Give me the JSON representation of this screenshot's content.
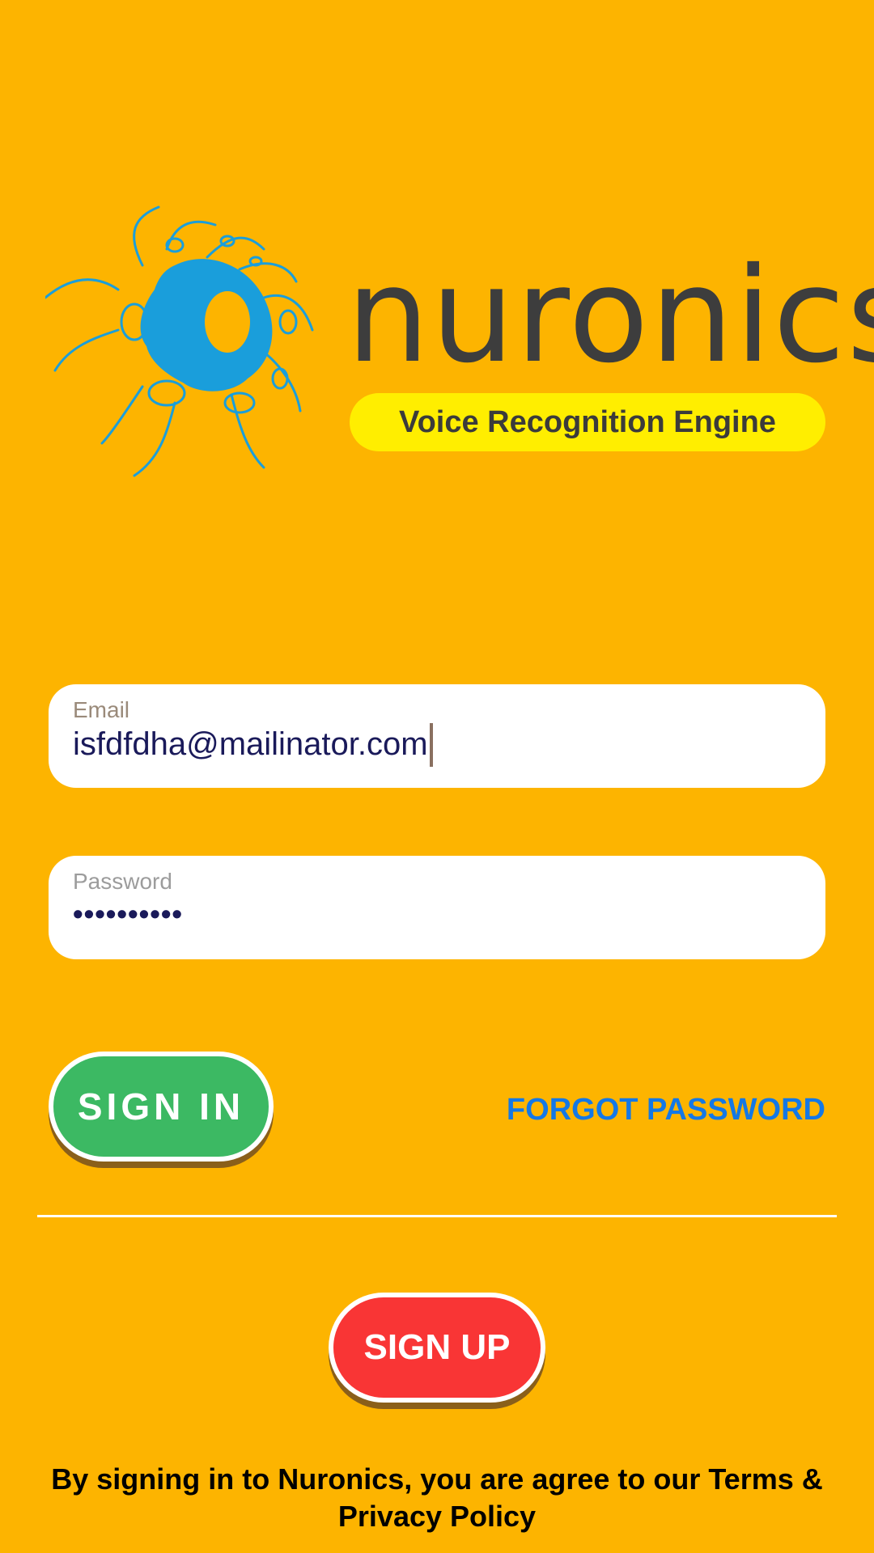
{
  "brand": {
    "name": "nuronics",
    "tagline": "Voice Recognition Engine",
    "logo_icon": "neuron-logo-icon",
    "colors": {
      "background": "#FDB400",
      "logo_blue": "#1A9EDB",
      "tagline_bg": "#FFEE00"
    }
  },
  "form": {
    "email": {
      "label": "Email",
      "value": "isfdfdha@mailinator.com"
    },
    "password": {
      "label": "Password",
      "value": "••••••••••"
    }
  },
  "actions": {
    "signin_label": "SIGN IN",
    "forgot_label": "FORGOT PASSWORD",
    "signup_label": "SIGN UP",
    "colors": {
      "signin": "#3CB963",
      "signup": "#F93535",
      "forgot": "#1478E6"
    }
  },
  "footer": {
    "terms_text": "By signing in to Nuronics, you are agree to our Terms & Privacy Policy"
  }
}
